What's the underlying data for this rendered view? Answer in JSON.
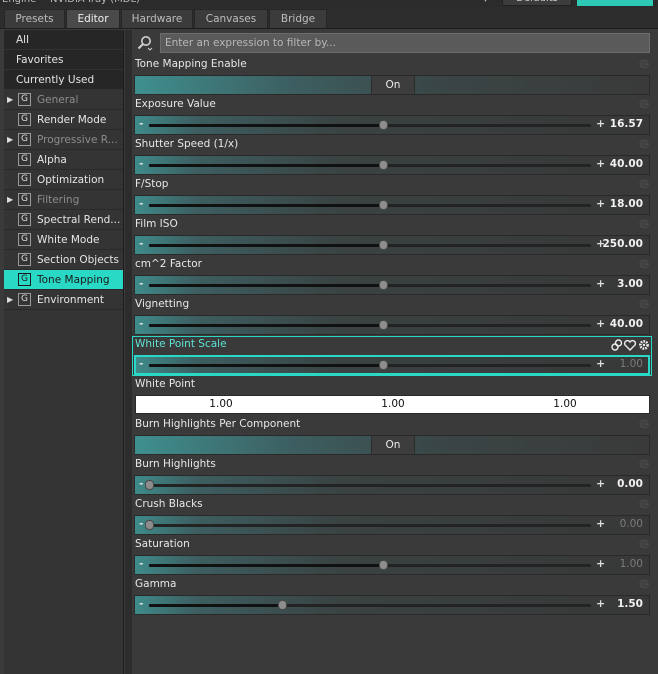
{
  "tabs": [
    {
      "label": "Presets",
      "active": false
    },
    {
      "label": "Editor",
      "active": true
    },
    {
      "label": "Hardware",
      "active": false
    },
    {
      "label": "Canvases",
      "active": false
    },
    {
      "label": "Bridge",
      "active": false
    }
  ],
  "sidebar": {
    "plain_items": [
      "All",
      "Favorites",
      "Currently Used"
    ],
    "group_items": [
      {
        "label": "General",
        "expandable": true,
        "dim": true
      },
      {
        "label": "Render Mode",
        "expandable": false,
        "dim": false
      },
      {
        "label": "Progressive R...",
        "expandable": true,
        "dim": true
      },
      {
        "label": "Alpha",
        "expandable": false,
        "dim": false
      },
      {
        "label": "Optimization",
        "expandable": false,
        "dim": false
      },
      {
        "label": "Filtering",
        "expandable": true,
        "dim": true
      },
      {
        "label": "Spectral Rend...",
        "expandable": false,
        "dim": false
      },
      {
        "label": "White Mode",
        "expandable": false,
        "dim": false
      },
      {
        "label": "Section Objects",
        "expandable": false,
        "dim": false
      },
      {
        "label": "Tone Mapping",
        "expandable": false,
        "dim": false,
        "selected": true
      },
      {
        "label": "Environment",
        "expandable": true,
        "dim": false
      }
    ],
    "group_badge": "G"
  },
  "search": {
    "placeholder": "Enter an expression to filter by..."
  },
  "properties": {
    "tone_mapping_enable": {
      "name": "Tone Mapping Enable",
      "value": "On"
    },
    "exposure_value": {
      "name": "Exposure Value",
      "value": "16.57",
      "level": 0.53
    },
    "shutter_speed": {
      "name": "Shutter Speed (1/x)",
      "value": "40.00",
      "level": 0.53
    },
    "f_stop": {
      "name": "F/Stop",
      "value": "18.00",
      "level": 0.53
    },
    "film_iso": {
      "name": "Film ISO",
      "value": "250.00",
      "level": 0.53
    },
    "cm2_factor": {
      "name": "cm^2 Factor",
      "value": "3.00",
      "level": 0.53
    },
    "vignetting": {
      "name": "Vignetting",
      "value": "40.00",
      "level": 0.53
    },
    "white_point_scale": {
      "name": "White Point Scale",
      "value": "1.00",
      "level": 0.53
    },
    "white_point": {
      "name": "White Point",
      "values": [
        "1.00",
        "1.00",
        "1.00"
      ]
    },
    "burn_highlights_per_component": {
      "name": "Burn Highlights Per Component",
      "value": "On"
    },
    "burn_highlights": {
      "name": "Burn Highlights",
      "value": "0.00",
      "level": 0.0
    },
    "crush_blacks": {
      "name": "Crush Blacks",
      "value": "0.00",
      "level": 0.0
    },
    "saturation": {
      "name": "Saturation",
      "value": "1.00",
      "level": 0.53
    },
    "gamma": {
      "name": "Gamma",
      "value": "1.50",
      "level": 0.3
    }
  },
  "colors": {
    "accent": "#2ad9c5",
    "panel": "#3a3a3a"
  }
}
